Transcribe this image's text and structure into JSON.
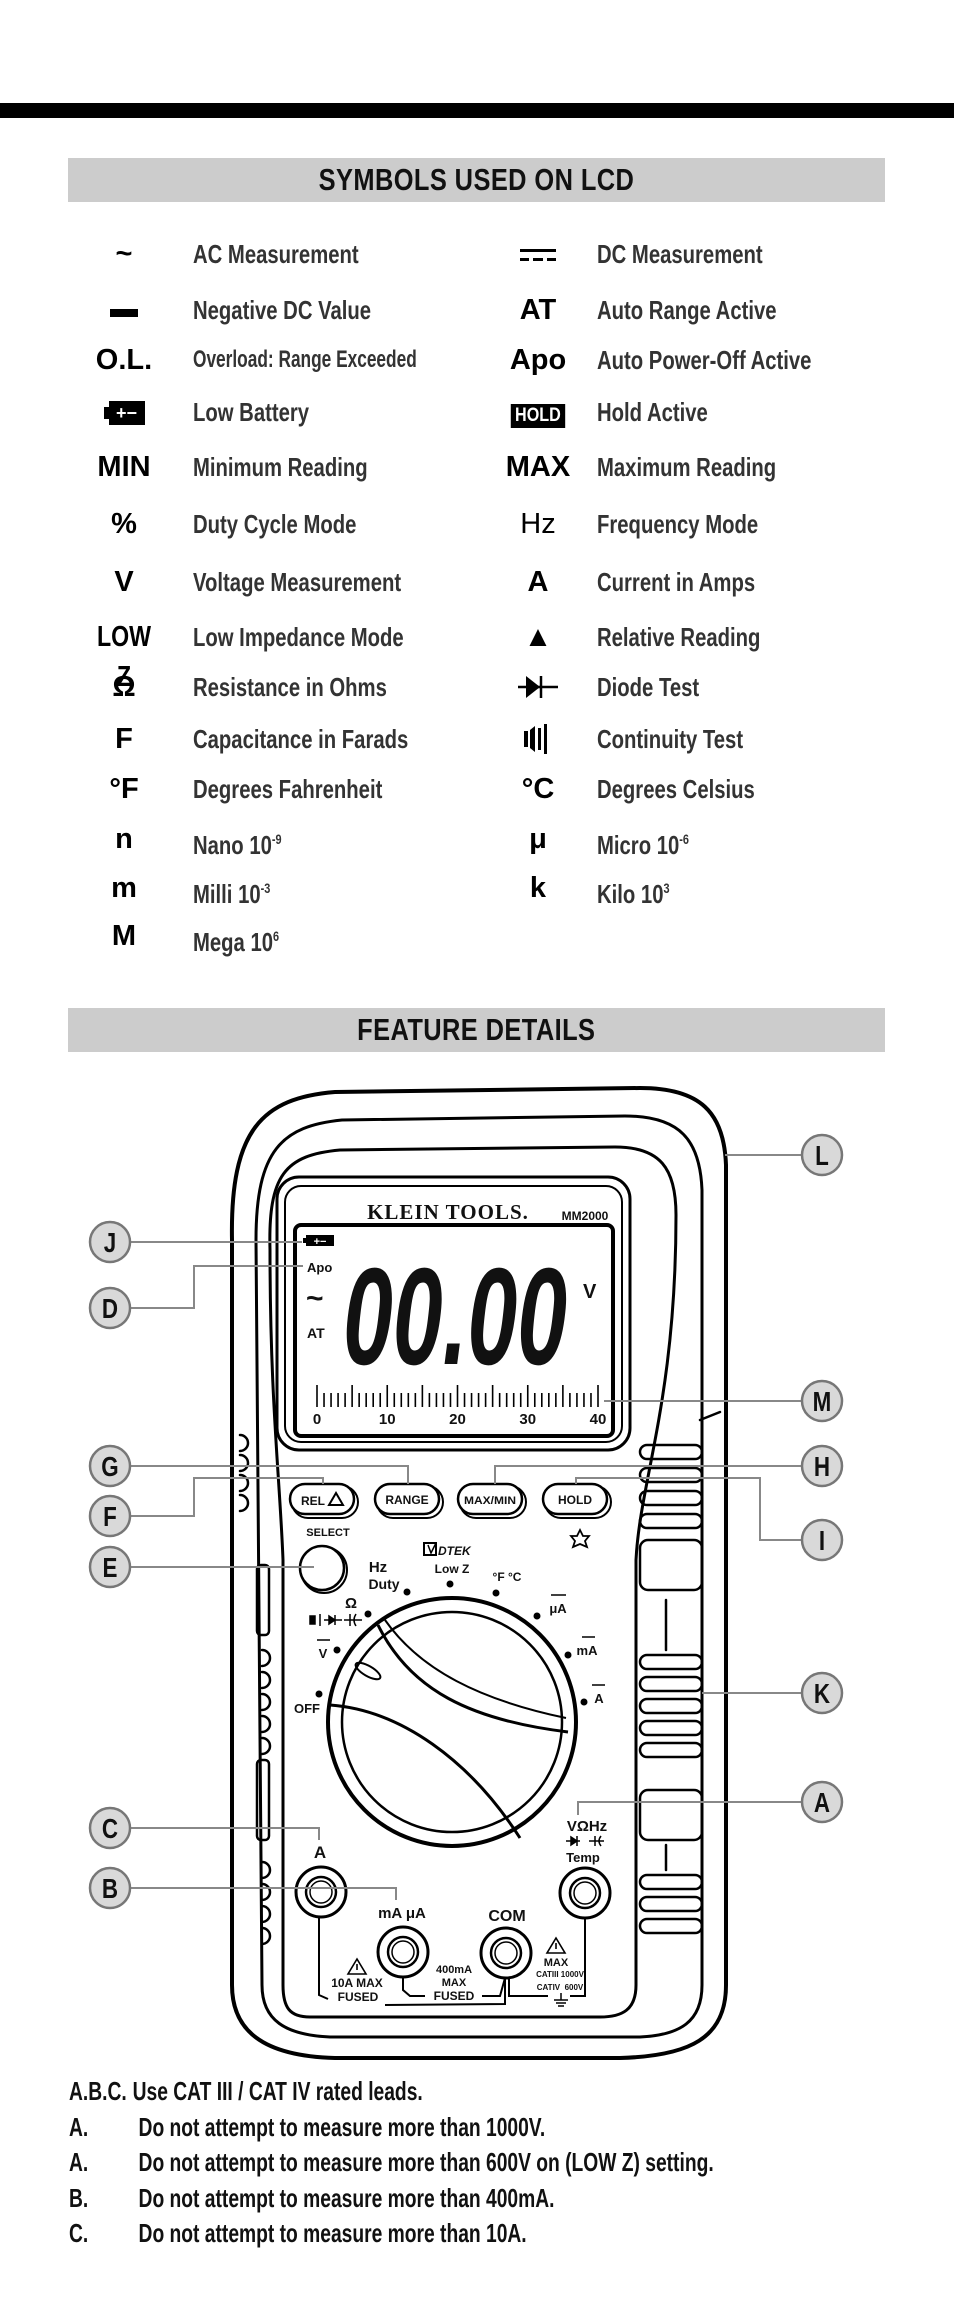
{
  "symbols_section": {
    "title": "SYMBOLS USED ON LCD",
    "left": [
      {
        "symbol": "~",
        "label": "AC Measurement"
      },
      {
        "icon": "negative-bar-icon",
        "label": "Negative DC Value"
      },
      {
        "symbol": "O.L.",
        "label": "Overload: Range Exceeded"
      },
      {
        "icon": "low-battery-icon",
        "icon_text": "+−",
        "label": "Low Battery"
      },
      {
        "symbol": "MIN",
        "label": "Minimum Reading"
      },
      {
        "symbol": "%",
        "label": "Duty Cycle Mode"
      },
      {
        "symbol": "V",
        "label": "Voltage Measurement"
      },
      {
        "symbol": "LOW Z",
        "label": "Low Impedance Mode"
      },
      {
        "symbol": "Ω",
        "label": "Resistance in Ohms"
      },
      {
        "symbol": "F",
        "label": "Capacitance in Farads"
      },
      {
        "symbol": "°F",
        "label": "Degrees Fahrenheit"
      },
      {
        "symbol": "n",
        "label": "Nano 10",
        "exp": "-9"
      },
      {
        "symbol": "m",
        "label": "Milli 10",
        "exp": "-3"
      },
      {
        "symbol": "M",
        "label": "Mega 10",
        "exp": "6"
      }
    ],
    "right": [
      {
        "icon": "dc-measurement-icon",
        "label": "DC Measurement"
      },
      {
        "symbol": "AT",
        "label": "Auto Range Active"
      },
      {
        "symbol": "Apo",
        "label": "Auto Power-Off Active"
      },
      {
        "boxed": "HOLD",
        "label": "Hold Active"
      },
      {
        "symbol": "MAX",
        "label": "Maximum Reading"
      },
      {
        "symbol": "Hz",
        "label": "Frequency Mode"
      },
      {
        "symbol": "A",
        "label": "Current in Amps"
      },
      {
        "symbol": "▲",
        "label": "Relative Reading"
      },
      {
        "icon": "diode-icon",
        "label": "Diode Test"
      },
      {
        "icon": "continuity-icon",
        "label": "Continuity Test"
      },
      {
        "symbol": "°C",
        "label": "Degrees Celsius"
      },
      {
        "symbol": "μ",
        "label": "Micro 10",
        "exp": "-6"
      },
      {
        "symbol": "k",
        "label": "Kilo 10",
        "exp": "3"
      }
    ]
  },
  "features_section": {
    "title": "FEATURE DETAILS",
    "meter": {
      "brand": "KLEIN TOOLS.",
      "model": "MM2000",
      "lcd": {
        "apo": "Apo",
        "ac": "~",
        "at": "AT",
        "reading": "00.00",
        "unit": "V",
        "battery_text": "+−",
        "scale_labels": [
          "0",
          "10",
          "20",
          "30",
          "40"
        ],
        "scale_max": 40
      },
      "buttons": {
        "rel": "REL",
        "range": "RANGE",
        "maxmin": "MAX/MIN",
        "hold": "HOLD",
        "select": "SELECT"
      },
      "dial": {
        "hz": "Hz",
        "duty": "Duty",
        "dtek": "DTEK",
        "lowz": "Low Z",
        "temp": "°F °C",
        "ua": "μA",
        "ma": "mA",
        "a": "A",
        "ohm": "Ω",
        "v": "V",
        "off": "OFF"
      },
      "jacks": {
        "a": "A",
        "maua": "mA μA",
        "com": "COM",
        "vohm": "VΩHz",
        "temp": "Temp",
        "fuse10_1": "10A MAX",
        "fuse10_2": "FUSED",
        "fuse400_1": "400mA",
        "fuse400_2": "MAX",
        "fuse400_3": "FUSED",
        "cat_max": "MAX",
        "cat3": "CATIII 1000V",
        "cat4": "CATIV  600V"
      }
    },
    "callouts": [
      "A",
      "B",
      "C",
      "D",
      "E",
      "F",
      "G",
      "H",
      "I",
      "J",
      "K",
      "L",
      "M"
    ]
  },
  "notes": [
    {
      "tag": "A.B.C.",
      "text": "Use CAT III / CAT IV rated leads."
    },
    {
      "tag": "A.",
      "text": "Do not attempt to measure more than 1000V."
    },
    {
      "tag": "A.",
      "text": "Do not attempt to measure more than 600V on (LOW Z) setting."
    },
    {
      "tag": "B.",
      "text": "Do not attempt to measure more than 400mA."
    },
    {
      "tag": "C.",
      "text": "Do not attempt to measure more than 10A."
    }
  ],
  "colors": {
    "header_bg": "#cccccc",
    "callout_bg": "#d9d9d9",
    "leader_line": "#888888",
    "label_text": "#333333"
  }
}
